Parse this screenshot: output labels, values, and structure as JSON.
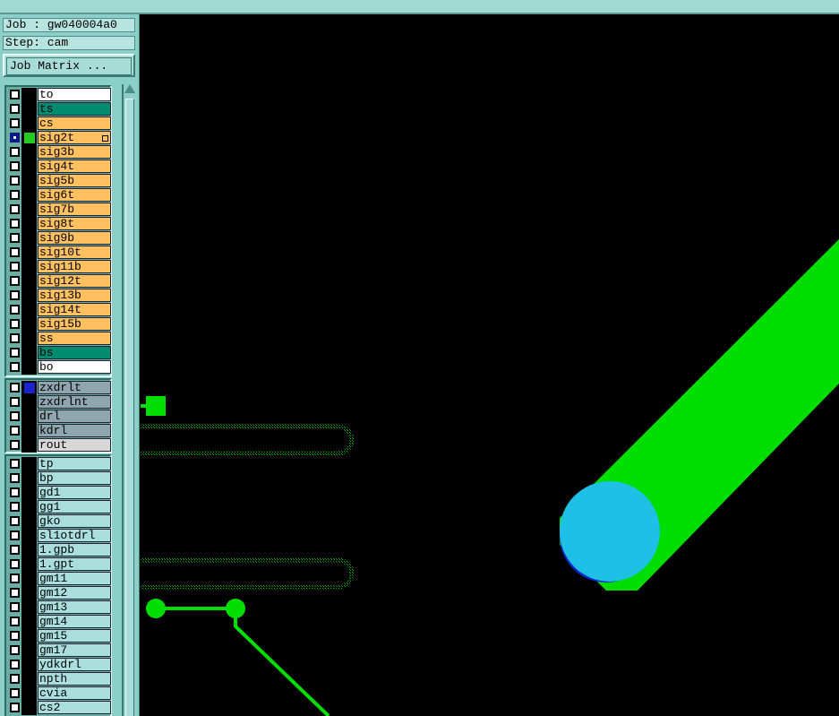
{
  "header": {
    "job": "Job : gw040004a0",
    "step": "Step: cam",
    "matrix_button": "Job Matrix ..."
  },
  "colors": {
    "board": "#ffc060",
    "solder_mask": "#008a70",
    "silk": "#ffffff",
    "drill": "#8fa6ae",
    "rout": "#d8d8d8",
    "misc": "#a9dedd",
    "copper_feature": "#00dd00",
    "pad_highlight": "#1ec0e6",
    "drill_hit": "#1428d0"
  },
  "board_layers": [
    {
      "name": "to",
      "type": "silk"
    },
    {
      "name": "ts",
      "type": "solder_mask"
    },
    {
      "name": "cs",
      "type": "board"
    },
    {
      "name": "sig2t",
      "type": "board",
      "selected": true,
      "swatch": "#22cc22",
      "expand": true
    },
    {
      "name": "sig3b",
      "type": "board"
    },
    {
      "name": "sig4t",
      "type": "board"
    },
    {
      "name": "sig5b",
      "type": "board"
    },
    {
      "name": "sig6t",
      "type": "board"
    },
    {
      "name": "sig7b",
      "type": "board"
    },
    {
      "name": "sig8t",
      "type": "board"
    },
    {
      "name": "sig9b",
      "type": "board"
    },
    {
      "name": "sig10t",
      "type": "board"
    },
    {
      "name": "sig11b",
      "type": "board"
    },
    {
      "name": "sig12t",
      "type": "board"
    },
    {
      "name": "sig13b",
      "type": "board"
    },
    {
      "name": "sig14t",
      "type": "board"
    },
    {
      "name": "sig15b",
      "type": "board"
    },
    {
      "name": "ss",
      "type": "board"
    },
    {
      "name": "bs",
      "type": "solder_mask"
    },
    {
      "name": "bo",
      "type": "silk"
    }
  ],
  "drill_layers": [
    {
      "name": "zxdrlt",
      "type": "drill",
      "swatch": "#1a24cc"
    },
    {
      "name": "zxdrlnt",
      "type": "drill"
    },
    {
      "name": "drl",
      "type": "drill"
    },
    {
      "name": "kdrl",
      "type": "drill"
    },
    {
      "name": "rout",
      "type": "rout"
    }
  ],
  "misc_layers": [
    {
      "name": "tp",
      "type": "misc"
    },
    {
      "name": "bp",
      "type": "misc"
    },
    {
      "name": "gd1",
      "type": "misc"
    },
    {
      "name": "gg1",
      "type": "misc"
    },
    {
      "name": "gko",
      "type": "misc"
    },
    {
      "name": "sl1otdrl",
      "type": "misc"
    },
    {
      "name": "1.gpb",
      "type": "misc"
    },
    {
      "name": "1.gpt",
      "type": "misc"
    },
    {
      "name": "gm11",
      "type": "misc"
    },
    {
      "name": "gm12",
      "type": "misc"
    },
    {
      "name": "gm13",
      "type": "misc"
    },
    {
      "name": "gm14",
      "type": "misc"
    },
    {
      "name": "gm15",
      "type": "misc"
    },
    {
      "name": "gm17",
      "type": "misc"
    },
    {
      "name": "ydkdrl",
      "type": "misc"
    },
    {
      "name": "npth",
      "type": "misc"
    },
    {
      "name": "cvia",
      "type": "misc"
    },
    {
      "name": "cs2",
      "type": "misc"
    }
  ]
}
